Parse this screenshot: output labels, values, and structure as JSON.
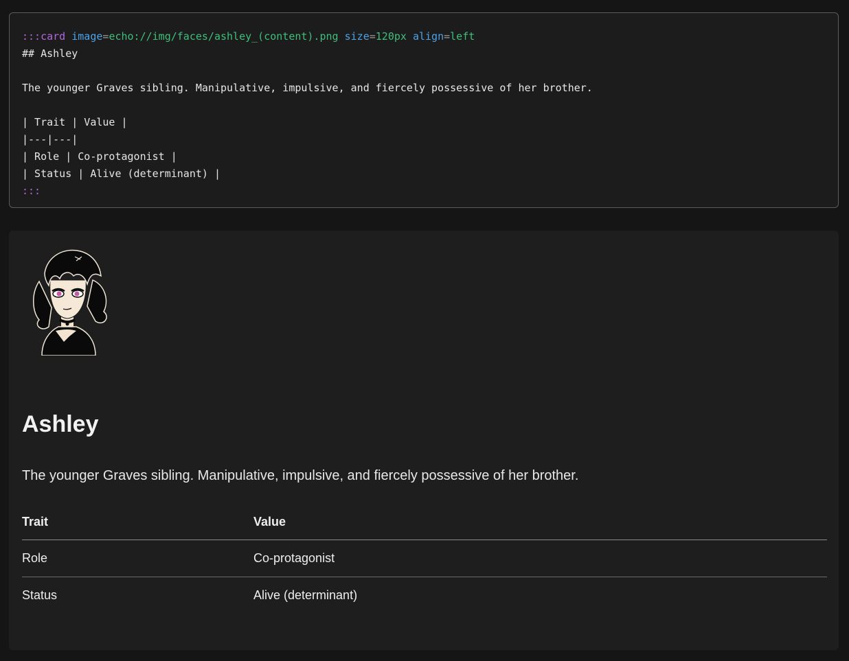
{
  "source": {
    "lines": [
      {
        "fence": ":::",
        "block": "card",
        "attrs": [
          {
            "key": "image",
            "eq": "=",
            "value": "echo://img/faces/ashley_(content).png"
          },
          {
            "key": "size",
            "eq": "=",
            "value": "120px"
          },
          {
            "key": "align",
            "eq": "=",
            "value": "left"
          }
        ]
      },
      {
        "text": "## Ashley"
      },
      {
        "text": ""
      },
      {
        "text": "The younger Graves sibling. Manipulative, impulsive, and fiercely possessive of her brother."
      },
      {
        "text": ""
      },
      {
        "text": "| Trait | Value |"
      },
      {
        "text": "|---|---|"
      },
      {
        "text": "| Role | Co-protagonist |"
      },
      {
        "text": "| Status | Alive (determinant) |"
      },
      {
        "fence": ":::"
      }
    ]
  },
  "card": {
    "image_alt": "Ashley portrait",
    "title": "Ashley",
    "description": "The younger Graves sibling. Manipulative, impulsive, and fiercely possessive of her brother.",
    "table": {
      "headers": [
        "Trait",
        "Value"
      ],
      "rows": [
        [
          "Role",
          "Co-protagonist"
        ],
        [
          "Status",
          "Alive (determinant)"
        ]
      ]
    }
  },
  "colors": {
    "page_bg": "#151515",
    "code_bg": "#1c1c1c",
    "card_bg": "#1e1e1e",
    "fence": "#b467dc",
    "attr_key": "#4ca3e8",
    "attr_value": "#3fbf7a"
  }
}
